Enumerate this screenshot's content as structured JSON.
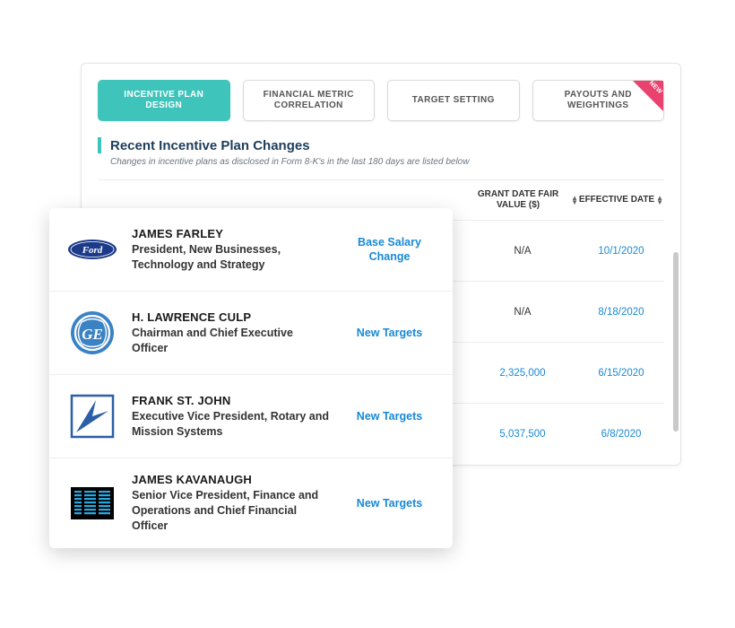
{
  "tabs": [
    {
      "label": "INCENTIVE PLAN DESIGN",
      "active": true,
      "new": false
    },
    {
      "label": "FINANCIAL METRIC CORRELATION",
      "active": false,
      "new": false
    },
    {
      "label": "TARGET SETTING",
      "active": false,
      "new": false
    },
    {
      "label": "PAYOUTS AND WEIGHTINGS",
      "active": false,
      "new": true
    }
  ],
  "new_badge": "NEW",
  "section": {
    "title": "Recent Incentive Plan Changes",
    "subtitle": "Changes in incentive plans as disclosed in Form 8-K's in the last 180 days are listed below"
  },
  "columns": {
    "fair_value": "GRANT DATE FAIR VALUE ($)",
    "effective_date": "EFFECTIVE DATE"
  },
  "back_rows": [
    {
      "fair_value": "N/A",
      "fair_na": true,
      "effective_date": "10/1/2020"
    },
    {
      "fair_value": "N/A",
      "fair_na": true,
      "effective_date": "8/18/2020"
    },
    {
      "fair_value": "2,325,000",
      "fair_na": false,
      "effective_date": "6/15/2020"
    },
    {
      "fair_value": "5,037,500",
      "fair_na": false,
      "effective_date": "6/8/2020"
    }
  ],
  "overlay_rows": [
    {
      "logo": "ford",
      "name": "JAMES FARLEY",
      "title": "President, New Businesses, Technology and Strategy",
      "action": "Base Salary Change"
    },
    {
      "logo": "ge",
      "name": "H. LAWRENCE CULP",
      "title": "Chairman and Chief Executive Officer",
      "action": "New Targets"
    },
    {
      "logo": "lockheed",
      "name": "FRANK ST. JOHN",
      "title": "Executive Vice President, Rotary and Mission Systems",
      "action": "New Targets"
    },
    {
      "logo": "ibm",
      "name": "JAMES KAVANAUGH",
      "title": "Senior Vice President, Finance and Operations and Chief Financial Officer",
      "action": "New Targets"
    }
  ]
}
